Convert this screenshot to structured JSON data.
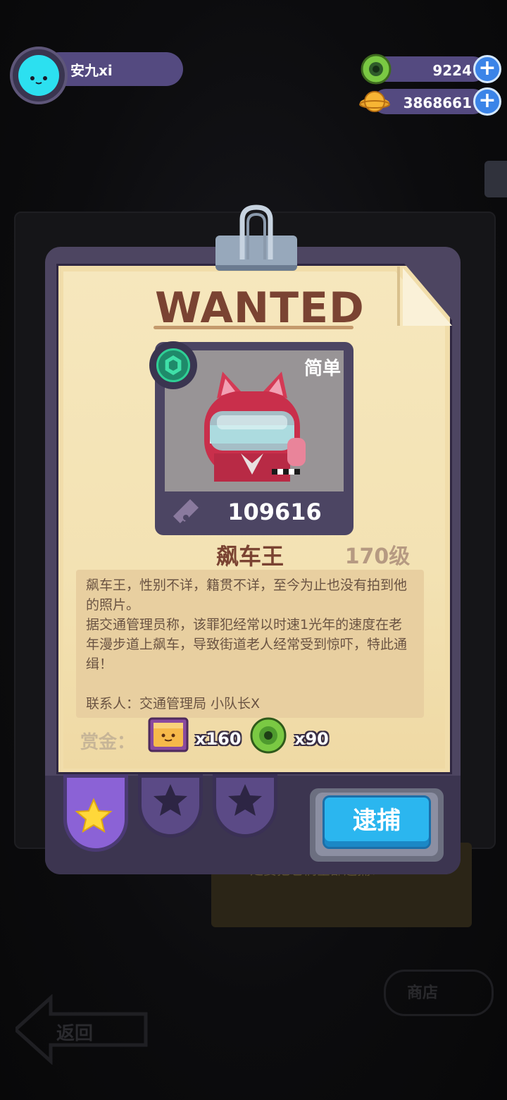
{
  "user": {
    "name": "安九xi"
  },
  "resources": [
    {
      "icon": "green-donut-coin-icon",
      "value": "9224"
    },
    {
      "icon": "planet-coin-icon",
      "value": "3868661"
    }
  ],
  "poster": {
    "title": "WANTED",
    "difficulty": "简单",
    "power": "109616",
    "target_name": "飙车王",
    "level": "170级",
    "description": [
      "飙车王，性别不详，籍贯不详，至今为止也没有拍到他的照片。",
      "据交通管理员称，该罪犯经常以时速1光年的速度在老年漫步道上飙车，导致街道老人经常受到惊吓，特此通缉！",
      "",
      "联系人：交通管理局 小队长X"
    ],
    "reward_label": "赏金：",
    "rewards": [
      {
        "icon": "treasure-chest-icon",
        "amount": "x160"
      },
      {
        "icon": "green-donut-coin-icon",
        "amount": "x90"
      }
    ]
  },
  "tabs": [
    {
      "name": "tab-star-1",
      "active": true
    },
    {
      "name": "tab-star-2",
      "active": false
    },
    {
      "name": "tab-star-3",
      "active": false
    }
  ],
  "arrest_button": "逮捕",
  "background": {
    "note_text": "…定要把它们全部逮捕！",
    "back_label": "返回",
    "shop_label": "商店"
  },
  "colors": {
    "accent_purple": "#544a80",
    "paper": "#f3e2b3",
    "title_brown": "#7a4332",
    "button_blue": "#2bb6ef"
  }
}
